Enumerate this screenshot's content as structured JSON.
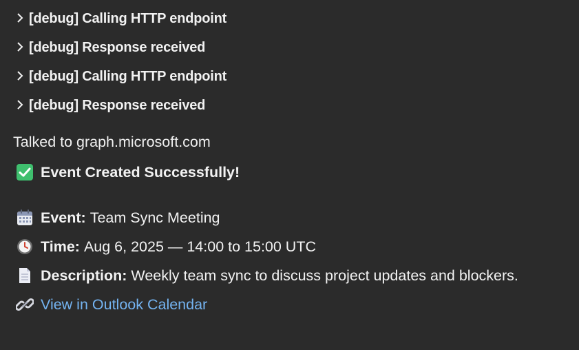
{
  "debug_entries": [
    {
      "label": "[debug] Calling HTTP endpoint"
    },
    {
      "label": "[debug] Response received"
    },
    {
      "label": "[debug] Calling HTTP endpoint"
    },
    {
      "label": "[debug] Response received"
    }
  ],
  "talked_to": "Talked to graph.microsoft.com",
  "success_message": "Event Created Successfully!",
  "event": {
    "label": "Event:",
    "value": "Team Sync Meeting"
  },
  "time": {
    "label": "Time:",
    "value": "Aug 6, 2025 — 14:00 to 15:00 UTC"
  },
  "description": {
    "label": "Description:",
    "value": "Weekly team sync to discuss project updates and blockers."
  },
  "link_text": "View in Outlook Calendar",
  "icons": {
    "chevron": "chevron-right-icon",
    "success": "check-mark-button-icon",
    "event": "calendar-icon",
    "time": "clock-icon",
    "description": "document-icon",
    "link": "link-icon"
  },
  "colors": {
    "background": "#2b2b2b",
    "text": "#f2f2f2",
    "link": "#74b3f0",
    "success_green": "#3fbf6e"
  }
}
